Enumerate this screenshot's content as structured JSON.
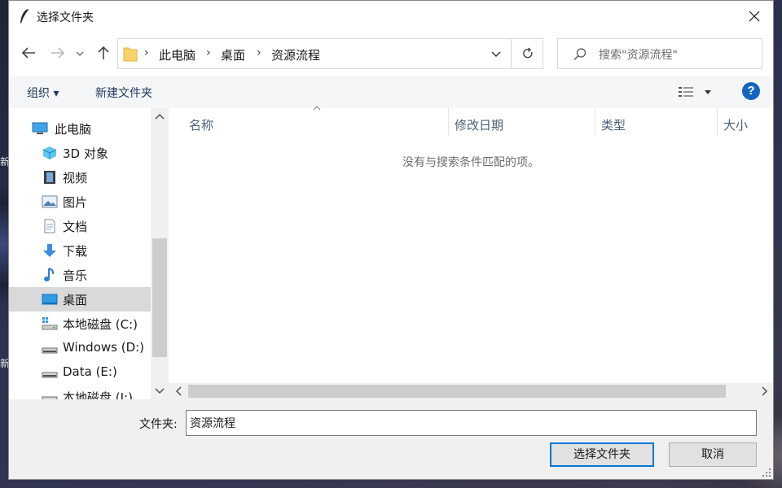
{
  "window": {
    "title": "选择文件夹"
  },
  "nav": {
    "back": "back",
    "forward": "forward",
    "recent": "recent-locations",
    "up": "up"
  },
  "address": {
    "breadcrumbs": [
      "此电脑",
      "桌面",
      "资源流程"
    ]
  },
  "search": {
    "placeholder": "搜索\"资源流程\""
  },
  "toolbar": {
    "organize": "组织 ▾",
    "new_folder": "新建文件夹",
    "help": "?"
  },
  "sidebar": {
    "items": [
      {
        "label": "此电脑",
        "icon": "computer-icon"
      },
      {
        "label": "3D 对象",
        "icon": "cube-icon"
      },
      {
        "label": "视频",
        "icon": "film-icon"
      },
      {
        "label": "图片",
        "icon": "picture-icon"
      },
      {
        "label": "文档",
        "icon": "document-icon"
      },
      {
        "label": "下载",
        "icon": "download-icon"
      },
      {
        "label": "音乐",
        "icon": "music-icon"
      },
      {
        "label": "桌面",
        "icon": "desktop-icon",
        "selected": true
      },
      {
        "label": "本地磁盘 (C:)",
        "icon": "system-drive-icon"
      },
      {
        "label": "Windows (D:)",
        "icon": "drive-icon"
      },
      {
        "label": "Data (E:)",
        "icon": "drive-icon"
      },
      {
        "label": "本地磁盘 (I:)",
        "icon": "drive-icon"
      }
    ]
  },
  "filelist": {
    "columns": [
      "名称",
      "修改日期",
      "类型",
      "大小"
    ],
    "empty_message": "没有与搜索条件匹配的项。"
  },
  "footer": {
    "folder_label": "文件夹:",
    "folder_value": "资源流程",
    "select_button": "选择文件夹",
    "cancel_button": "取消"
  },
  "colors": {
    "accent": "#0078d7",
    "selected_bg": "#d9d9d9",
    "help_blue": "#1565c0"
  }
}
